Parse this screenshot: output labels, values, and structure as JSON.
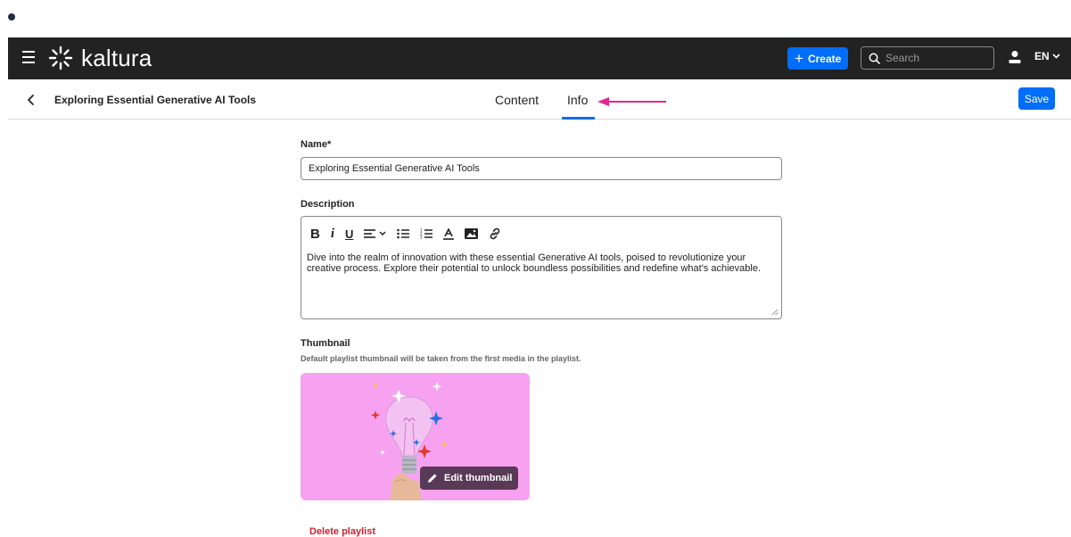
{
  "app": {
    "logo_text": "kaltura",
    "create_label": "Create",
    "search_placeholder": "Search",
    "language": "EN",
    "accent_color": "#006efa",
    "header_bg": "#222222"
  },
  "subheader": {
    "title": "Exploring Essential Generative AI Tools",
    "tabs": [
      {
        "label": "Content",
        "active": false
      },
      {
        "label": "Info",
        "active": true
      }
    ],
    "save_label": "Save"
  },
  "form": {
    "name_label": "Name",
    "name_required_mark": "*",
    "name_value": "Exploring Essential Generative AI Tools",
    "description_label": "Description",
    "description_text": "Dive into the realm of innovation with these essential Generative AI tools, poised to revolutionize your creative process. Explore their potential to unlock boundless possibilities and redefine what's achievable.",
    "toolbar_icons": [
      "bold-icon",
      "italic-icon",
      "underline-icon",
      "align-icon",
      "chevron-down-icon",
      "bullet-list-icon",
      "numbered-list-icon",
      "text-color-icon",
      "image-icon",
      "link-icon"
    ],
    "thumbnail_label": "Thumbnail",
    "thumbnail_hint": "Default playlist thumbnail will be taken from the first media in the playlist.",
    "edit_thumbnail_label": "Edit thumbnail",
    "delete_label": "Delete playlist",
    "delete_color": "#d21f2c",
    "thumbnail_bg": "#f7a2f1"
  }
}
